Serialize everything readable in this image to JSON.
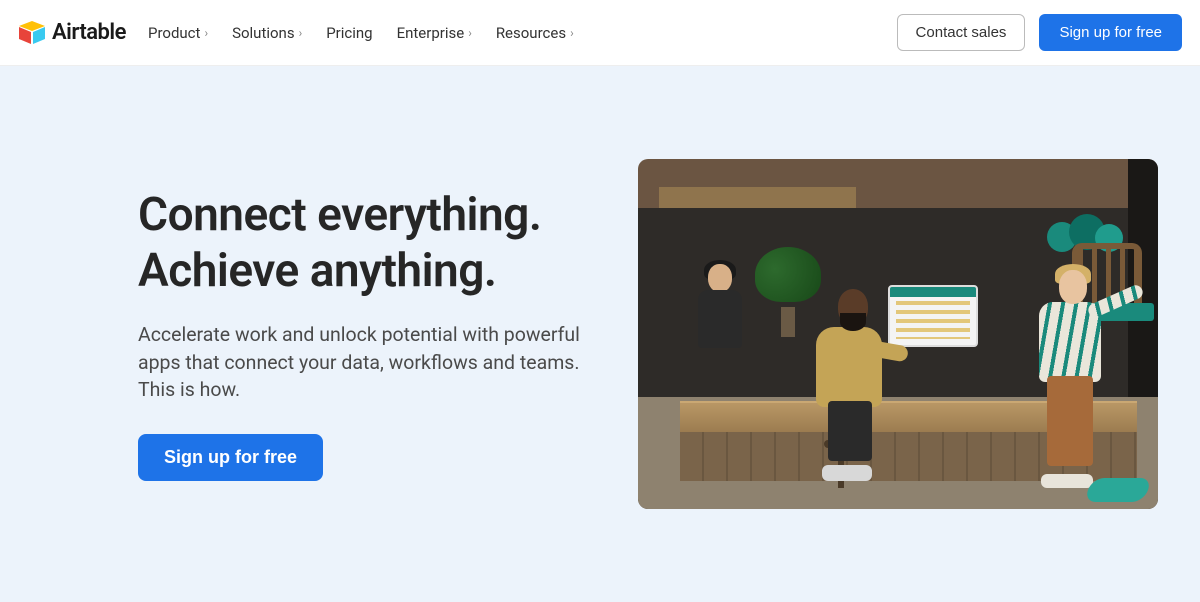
{
  "brand": {
    "name": "Airtable"
  },
  "nav": {
    "items": [
      {
        "label": "Product",
        "has_menu": true
      },
      {
        "label": "Solutions",
        "has_menu": true
      },
      {
        "label": "Pricing",
        "has_menu": false
      },
      {
        "label": "Enterprise",
        "has_menu": true
      },
      {
        "label": "Resources",
        "has_menu": true
      }
    ]
  },
  "header_actions": {
    "contact_label": "Contact sales",
    "signup_label": "Sign up for free"
  },
  "hero": {
    "headline": "Connect everything. Achieve anything.",
    "subhead": "Accelerate work and unlock potential with powerful apps that connect your data, workflows and teams. This is how.",
    "cta_label": "Sign up for free"
  }
}
